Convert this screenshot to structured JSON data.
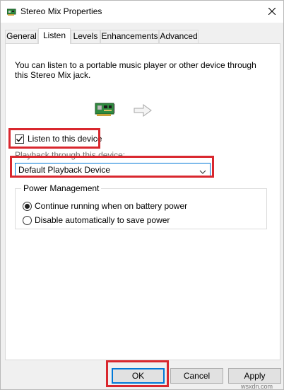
{
  "window": {
    "title": "Stereo Mix Properties"
  },
  "tabs": [
    {
      "label": "General",
      "active": false
    },
    {
      "label": "Listen",
      "active": true
    },
    {
      "label": "Levels",
      "active": false
    },
    {
      "label": "Enhancements",
      "active": false
    },
    {
      "label": "Advanced",
      "active": false
    }
  ],
  "listen": {
    "description": "You can listen to a portable music player or other device through this Stereo Mix jack.",
    "checkbox_label": "Listen to this device",
    "checkbox_checked": true,
    "playback_label": "Playback through this device:",
    "playback_value": "Default Playback Device"
  },
  "power": {
    "title": "Power Management",
    "options": [
      {
        "label": "Continue running when on battery power",
        "selected": true
      },
      {
        "label": "Disable automatically to save power",
        "selected": false
      }
    ]
  },
  "buttons": {
    "ok": "OK",
    "cancel": "Cancel",
    "apply": "Apply"
  },
  "watermark": "wsxdn.com",
  "colors": {
    "highlight": "#d9272e",
    "accent": "#0078d7",
    "card_green": "#2e8b3e"
  },
  "icons": {
    "title": "sound-card-icon",
    "close": "close-icon",
    "device": "sound-card-icon",
    "arrow": "arrow-right-icon",
    "dropdown": "chevron-down-icon"
  }
}
